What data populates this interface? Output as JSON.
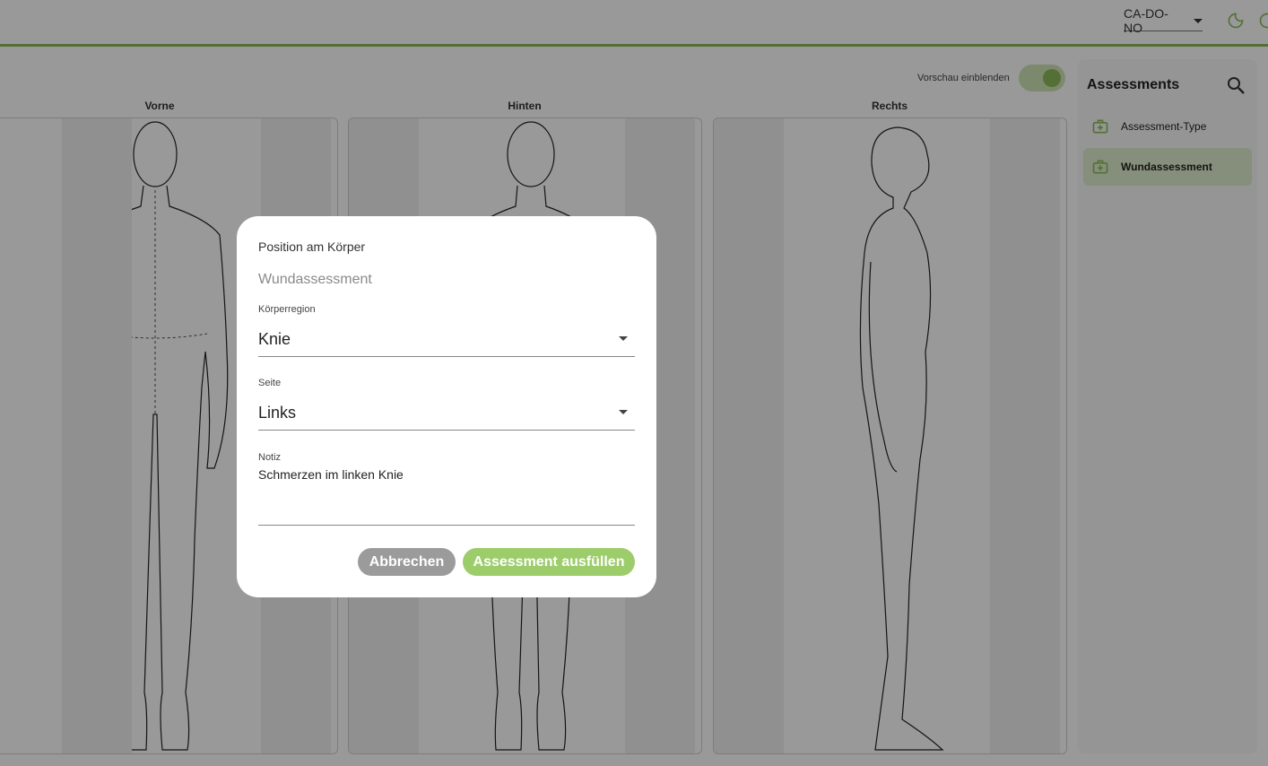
{
  "header": {
    "workspace": "CA-DO-NO",
    "accent": "#8dbb5a"
  },
  "views": {
    "preview_label": "Vorschau einblenden",
    "front": "Vorne",
    "back": "Hinten",
    "right": "Rechts"
  },
  "sidebar": {
    "title": "Assessments",
    "items": [
      {
        "label": "Assessment-Type",
        "icon": "medical-bag-icon"
      },
      {
        "label": "Wundassessment",
        "icon": "medical-bag-icon"
      }
    ]
  },
  "dialog": {
    "title": "Position am Körper",
    "subtitle": "Wundassessment",
    "region_label": "Körperregion",
    "region_value": "Knie",
    "side_label": "Seite",
    "side_value": "Links",
    "note_label": "Notiz",
    "note_value": "Schmerzen im linken Knie",
    "cancel": "Abbrechen",
    "submit": "Assessment ausfüllen"
  }
}
